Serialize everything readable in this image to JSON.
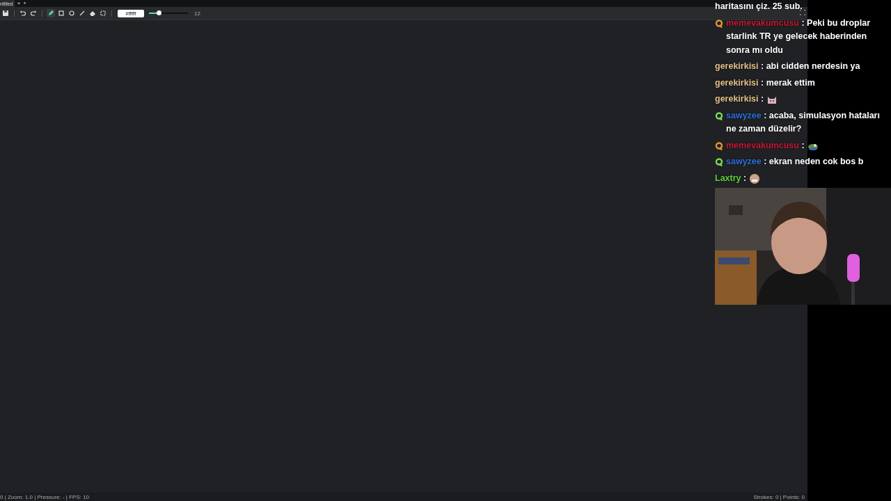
{
  "tabs": [
    {
      "label": "ntitled",
      "selected": true,
      "close": "×"
    }
  ],
  "new_tab": "+",
  "toolbar": {
    "actions": [
      {
        "kind": "save"
      },
      {
        "kind": "undo"
      },
      {
        "kind": "redo"
      }
    ],
    "tools": [
      {
        "kind": "pen",
        "selected": true
      },
      {
        "kind": "rectangle",
        "selected": false
      },
      {
        "kind": "ellipse",
        "selected": false
      },
      {
        "kind": "line",
        "selected": false
      },
      {
        "kind": "eraser",
        "selected": false
      },
      {
        "kind": "select",
        "selected": false
      }
    ],
    "color": {
      "value": "#ffffff"
    },
    "brush_size": {
      "level": 0.25,
      "reading": "12"
    }
  },
  "status_bar": {
    "left": "0 | Zoom: 1.0 | Pressure: - | FPS: 10",
    "right": "Strokes: 0 | Points: 0"
  },
  "chat": {
    "messages": [
      {
        "text": "haritasını çiz. 25 sub."
      },
      {
        "badge": {
          "color": "#e8962a"
        },
        "user": "memevakumcusu",
        "color": "#c41a36",
        "text": ": Peki bu droplar starlink TR ye gelecek haberinden sonra mı oldu"
      },
      {
        "user": "gerekirkisi",
        "color": "#e6c08a",
        "text": ": abi cidden nerdesin ya"
      },
      {
        "user": "gerekirkisi",
        "color": "#e6c08a",
        "text": ": merak ettim"
      },
      {
        "user": "gerekirkisi",
        "color": "#e6c08a",
        "text": ":",
        "kind": "cat"
      },
      {
        "badge": {
          "color": "#7ed957"
        },
        "user": "sawyzee",
        "color": "#2e6fd8",
        "text": ": acaba, simulasyon hataları ne zaman düzelir?"
      },
      {
        "badge": {
          "color": "#e8962a"
        },
        "user": "memevakumcusu",
        "color": "#c41a36",
        "text": ":",
        "kind": "frog"
      },
      {
        "badge": {
          "color": "#7ed957"
        },
        "user": "sawyzee",
        "color": "#2e6fd8",
        "text": ": ekran neden cok bos b"
      },
      {
        "user": "Laxtry",
        "color": "#5fd23c",
        "text": ":",
        "kind": "blob"
      }
    ]
  }
}
